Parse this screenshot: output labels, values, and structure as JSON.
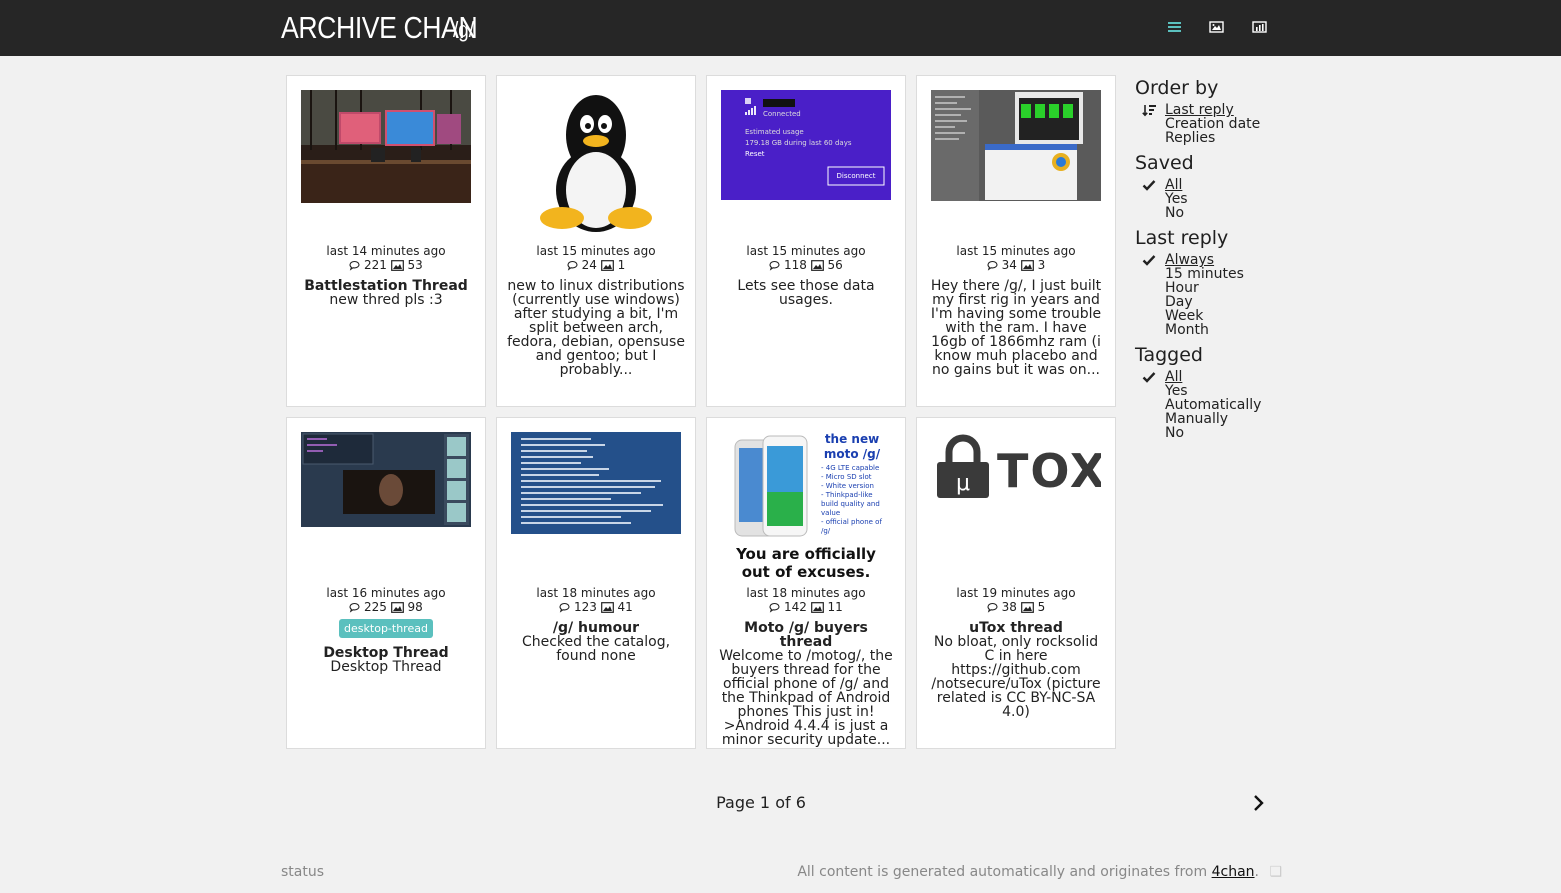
{
  "header": {
    "title": "ARCHIVE CHAN",
    "board": "/g/",
    "icons": [
      "list-icon",
      "image-icon",
      "stats-icon"
    ],
    "accent": "#5bc0be"
  },
  "threads": [
    {
      "ago": "last 14 minutes ago",
      "replies": "221",
      "images": "53",
      "subject": "Battlestation Thread",
      "text": "new thred pls :3"
    },
    {
      "ago": "last 15 minutes ago",
      "replies": "24",
      "images": "1",
      "subject": "",
      "text": "new to linux distributions (currently use windows) after studying a bit, I'm split between arch, fedora, debian, opensuse and gentoo; but I probably..."
    },
    {
      "ago": "last 15 minutes ago",
      "replies": "118",
      "images": "56",
      "subject": "",
      "text": "Lets see those data usages.",
      "thumb": {
        "status": "Connected",
        "usage_label": "Estimated usage",
        "usage_value": "179.18 GB during last 60 days",
        "reset": "Reset",
        "button": "Disconnect"
      }
    },
    {
      "ago": "last 15 minutes ago",
      "replies": "34",
      "images": "3",
      "subject": "",
      "text": "Hey there /g/, I just built my first rig in years and I'm having some trouble with the ram. I have 16gb of 1866mhz ram (i know muh placebo and no gains but it was on..."
    },
    {
      "ago": "last 16 minutes ago",
      "replies": "225",
      "images": "98",
      "tag": "desktop-thread",
      "subject": "Desktop Thread",
      "text": "Desktop Thread"
    },
    {
      "ago": "last 18 minutes ago",
      "replies": "123",
      "images": "41",
      "subject": "/g/ humour",
      "text": "Checked the catalog, found none"
    },
    {
      "ago": "last 18 minutes ago",
      "replies": "142",
      "images": "11",
      "subject": "Moto /g/ buyers thread",
      "text": "Welcome to /motog/, the buyers thread for the official phone of /g/ and the Thinkpad of Android phones This just in! >Android 4.4.4 is just a minor security update...",
      "thumb": {
        "headline": "the new moto /g/",
        "bullets": [
          "- 4G LTE capable",
          "- Micro SD slot",
          "- White version",
          "- Thinkpad-like build quality and value",
          "- official phone of /g/"
        ],
        "caption": "You are officially out of excuses."
      }
    },
    {
      "ago": "last 19 minutes ago",
      "replies": "38",
      "images": "5",
      "subject": "uTox thread",
      "text": "No bloat, only rocksolid C in here https://github.com /notsecure/uTox (picture related is CC BY-NC-SA 4.0)",
      "thumb": {
        "logo": "TOX"
      }
    }
  ],
  "sidebar": {
    "order": {
      "title": "Order by",
      "items": [
        "Last reply",
        "Creation date",
        "Replies"
      ],
      "selected": 0
    },
    "saved": {
      "title": "Saved",
      "items": [
        "All",
        "Yes",
        "No"
      ],
      "selected": 0
    },
    "last_reply": {
      "title": "Last reply",
      "items": [
        "Always",
        "15 minutes",
        "Hour",
        "Day",
        "Week",
        "Month"
      ],
      "selected": 0
    },
    "tagged": {
      "title": "Tagged",
      "items": [
        "All",
        "Yes",
        "Automatically",
        "Manually",
        "No"
      ],
      "selected": 0
    }
  },
  "pager": {
    "label": "Page 1 of 6"
  },
  "footer": {
    "status": "status",
    "credit": "All content is generated automatically and originates from",
    "link": "4chan",
    "period": "."
  }
}
